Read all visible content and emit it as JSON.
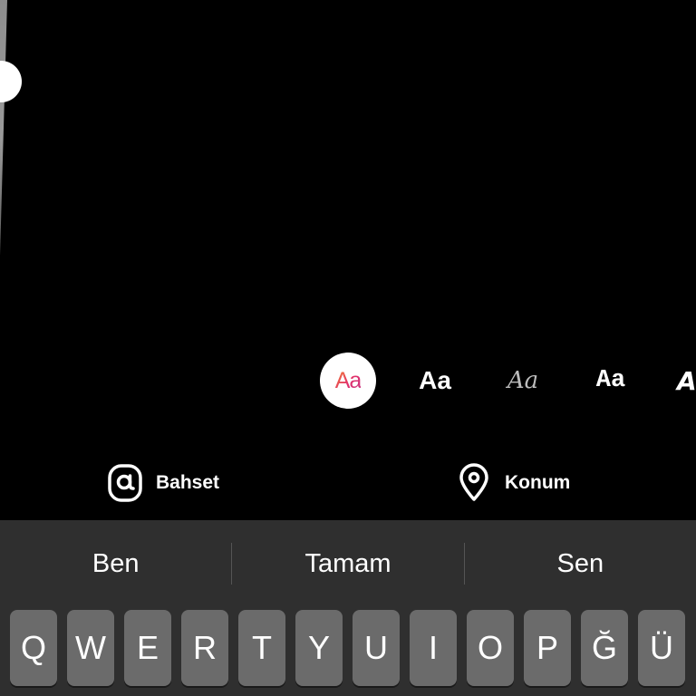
{
  "font_styles": [
    {
      "label": "Aa",
      "name": "modern",
      "selected": true
    },
    {
      "label": "Aa",
      "name": "classic",
      "selected": false
    },
    {
      "label": "Aa",
      "name": "script",
      "selected": false
    },
    {
      "label": "Aa",
      "name": "typewriter",
      "selected": false
    },
    {
      "label": "A",
      "name": "strong",
      "selected": false
    }
  ],
  "actions": {
    "mention": {
      "label": "Bahset",
      "icon": "at-sign-icon"
    },
    "location": {
      "label": "Konum",
      "icon": "location-pin-icon"
    }
  },
  "suggestions": [
    "Ben",
    "Tamam",
    "Sen"
  ],
  "keys": [
    "Q",
    "W",
    "E",
    "R",
    "T",
    "Y",
    "U",
    "I",
    "O",
    "P",
    "Ğ",
    "Ü"
  ],
  "colors": {
    "background": "#000000",
    "keyboard_bg": "#2f2f2f",
    "key_bg": "#6b6b6b",
    "accent_gradient_start": "#f58529",
    "accent_gradient_end": "#c13584"
  }
}
